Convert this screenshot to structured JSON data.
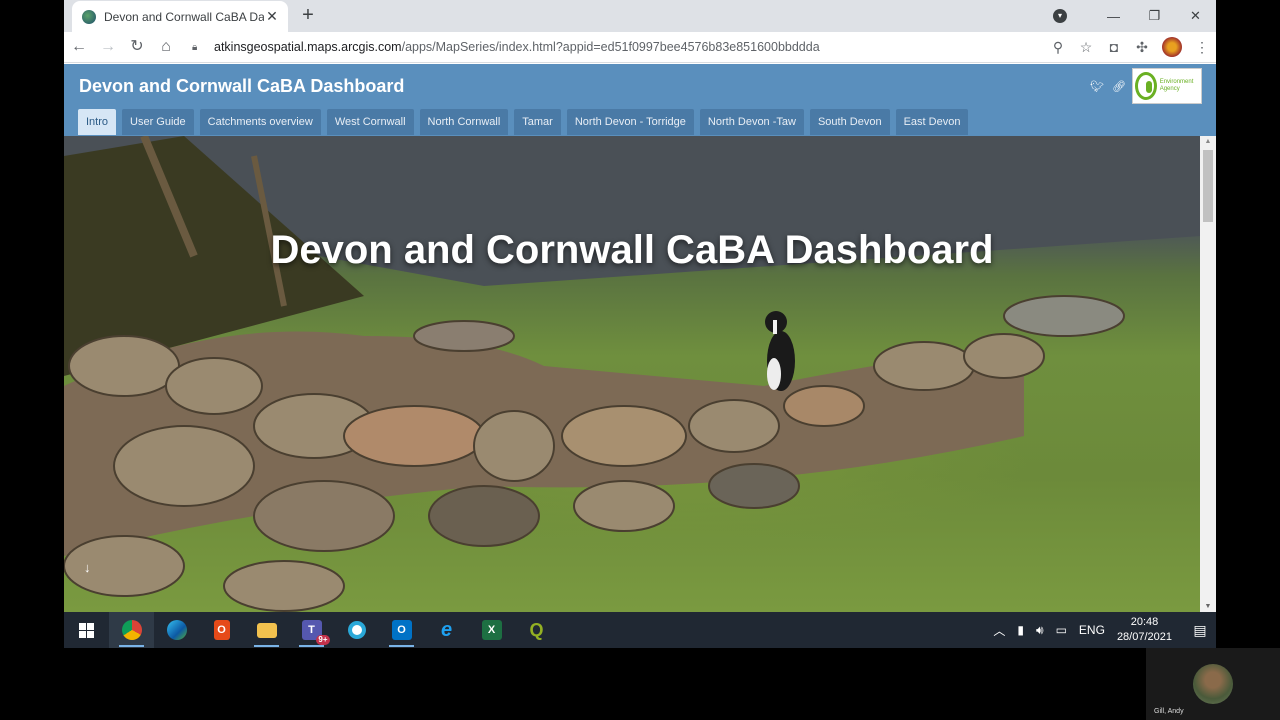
{
  "browser": {
    "tab_title": "Devon and Cornwall CaBA Dashb",
    "new_tab": "+",
    "url_host": "atkinsgeospatial.maps.arcgis.com",
    "url_path": "/apps/MapSeries/index.html?appid=ed51f0997bee4576b83e851600bbddda"
  },
  "app": {
    "title": "Devon and Cornwall CaBA Dashboard",
    "logo_text": "Environment Agency",
    "tabs": [
      {
        "label": "Intro",
        "active": true
      },
      {
        "label": "User Guide"
      },
      {
        "label": "Catchments overview"
      },
      {
        "label": "West Cornwall"
      },
      {
        "label": "North Cornwall"
      },
      {
        "label": "Tamar"
      },
      {
        "label": "North Devon - Torridge"
      },
      {
        "label": "North Devon -Taw"
      },
      {
        "label": "South Devon"
      },
      {
        "label": "East Devon"
      }
    ]
  },
  "hero": {
    "title": "Devon and Cornwall CaBA Dashboard",
    "scroll_hint": "↓"
  },
  "taskbar": {
    "language": "ENG",
    "time": "20:48",
    "date": "28/07/2021",
    "teams_badge": "9+",
    "apps": [
      "windows-start",
      "chrome",
      "edge",
      "office",
      "file-explorer",
      "teams",
      "cortana",
      "outlook",
      "internet-explorer",
      "excel",
      "qgis"
    ]
  },
  "call": {
    "participant_name": "Gill, Andy"
  },
  "colors": {
    "header_blue": "#5a8fbd",
    "tab_blue": "#4a7aa6",
    "active_tab": "#d6e6f5"
  }
}
